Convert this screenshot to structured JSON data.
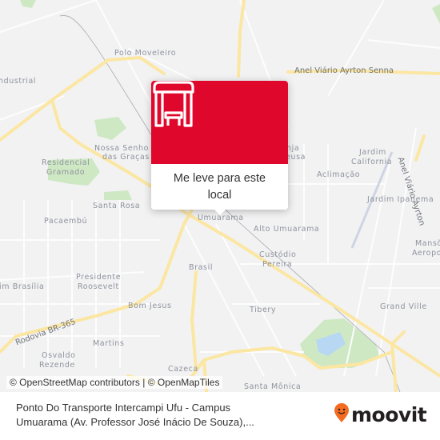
{
  "map": {
    "attribution": "© OpenStreetMap contributors | © OpenMapTiles",
    "places": [
      {
        "id": "polo-moveleiro",
        "label": "Polo Moveleiro"
      },
      {
        "id": "industrial",
        "label": "ndustrial"
      },
      {
        "id": "nossa-senhora",
        "label": "Nossa Senho"
      },
      {
        "id": "das-gracas",
        "label": "das Graças"
      },
      {
        "id": "residencial-gramado-1",
        "label": "Residencial"
      },
      {
        "id": "residencial-gramado-2",
        "label": "Gramado"
      },
      {
        "id": "santa-rosa",
        "label": "Santa Rosa"
      },
      {
        "id": "pacaembu",
        "label": "Pacaembú"
      },
      {
        "id": "umuarama",
        "label": "Umuarama"
      },
      {
        "id": "alto-umuarama",
        "label": "Alto Umuarama"
      },
      {
        "id": "custodio-pereira-1",
        "label": "Custódio"
      },
      {
        "id": "custodio-pereira-2",
        "label": "Pereira"
      },
      {
        "id": "brasil",
        "label": "Brasil"
      },
      {
        "id": "presidente-roosevelt-1",
        "label": "Presidente"
      },
      {
        "id": "presidente-roosevelt-2",
        "label": "Roosevelt"
      },
      {
        "id": "jardim-brasilia",
        "label": "im Brasília"
      },
      {
        "id": "bom-jesus",
        "label": "Bom Jesus"
      },
      {
        "id": "tibery",
        "label": "Tibery"
      },
      {
        "id": "martins",
        "label": "Martins"
      },
      {
        "id": "osvaldo-rezende-1",
        "label": "Osvaldo"
      },
      {
        "id": "osvaldo-rezende-2",
        "label": "Rezende"
      },
      {
        "id": "cazeca",
        "label": "Cazeca"
      },
      {
        "id": "santa-monica",
        "label": "Santa Mônica"
      },
      {
        "id": "granja-1",
        "label": "nja"
      },
      {
        "id": "granja-2",
        "label": "eusa"
      },
      {
        "id": "jardim-california-1",
        "label": "Jardim"
      },
      {
        "id": "jardim-california-2",
        "label": "California"
      },
      {
        "id": "aclimacao",
        "label": "Aclimação"
      },
      {
        "id": "jardim-ipanema",
        "label": "Jardim Ipanema"
      },
      {
        "id": "mansoes-1",
        "label": "Mansõ"
      },
      {
        "id": "mansoes-2",
        "label": "Aeropo"
      },
      {
        "id": "grand-ville",
        "label": "Grand Ville"
      }
    ],
    "roads": [
      {
        "id": "anel-viario",
        "label": "Anel Viário Ayrton Senna"
      },
      {
        "id": "anel-viario-vertical",
        "label": "Anel Viário Ayrton"
      },
      {
        "id": "rodovia-br365",
        "label": "Rodovia BR-365"
      }
    ]
  },
  "popup": {
    "icon": "bus-stop-icon",
    "accent_color": "#e0072c",
    "action_label": "Me leve para este local"
  },
  "footer": {
    "title_line1": "Ponto Do Transporte Intercampi Ufu - Campus",
    "title_line2": "Umuarama (Av. Professor José Inácio De Souza),...",
    "brand": "moovit",
    "brand_color": "#f26b21"
  }
}
